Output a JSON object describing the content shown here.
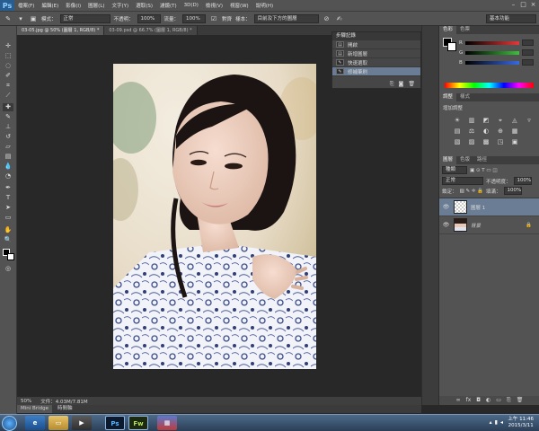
{
  "app": {
    "logo": "Ps"
  },
  "menubar": {
    "items": [
      "檔案(F)",
      "編輯(E)",
      "影像(I)",
      "圖層(L)",
      "文字(Y)",
      "選取(S)",
      "濾鏡(T)",
      "3D(D)",
      "檢視(V)",
      "視窗(W)",
      "說明(H)"
    ]
  },
  "options": {
    "mode_label": "模式：",
    "mode_value": "正常",
    "opacity_label": "不透明：",
    "opacity_value": "100%",
    "flow_label": "流量：",
    "flow_value": "100%",
    "align_label": "對齊",
    "sample_label": "樣本：",
    "sample_value": "目前及下方的圖層",
    "workspace": "基本功能"
  },
  "tabs": [
    {
      "label": "03-05.jpg @ 50% (圖層 1, RGB/8) *",
      "active": true
    },
    {
      "label": "03-09.psd @ 66.7% (圖層 1, RGB/8) *",
      "active": false
    }
  ],
  "history": {
    "title": "步驟記錄",
    "rows": [
      {
        "label": "開啟",
        "icon": "document-icon",
        "selected": false
      },
      {
        "label": "新增圖層",
        "icon": "layer-icon",
        "selected": false
      },
      {
        "label": "快速選取",
        "icon": "brush-icon",
        "selected": false
      },
      {
        "label": "修補筆刷",
        "icon": "brush-icon",
        "selected": true
      }
    ]
  },
  "status": {
    "zoom": "50%",
    "doc": "文件：4.03M/7.81M"
  },
  "bottom_tabs": [
    "Mini Bridge",
    "時間軸"
  ],
  "color_panel": {
    "tabs": [
      "色彩",
      "色票"
    ],
    "labels": [
      "R",
      "G",
      "B"
    ],
    "colors": {
      "r": "#e23a3a",
      "g": "#3ac23a",
      "b": "#3a6ae2"
    }
  },
  "adjust_panel": {
    "tabs": [
      "調整",
      "樣式"
    ],
    "title": "增加調整",
    "icons": [
      "☀",
      "▥",
      "◩",
      "⌖",
      "◬",
      "▿",
      "▤",
      "⚖",
      "◐",
      "⊕",
      "▦",
      "",
      "▧",
      "▨",
      "▩",
      "◳",
      "▣",
      ""
    ]
  },
  "layers_panel": {
    "tabs": [
      "圖層",
      "色版",
      "路徑"
    ],
    "kind": "種類",
    "blend": "正常",
    "opacity_label": "不透明度：",
    "opacity": "100%",
    "lock_label": "鎖定：",
    "fill_label": "填滿：",
    "fill": "100%",
    "layers": [
      {
        "name": "圖層 1",
        "selected": true,
        "lock": ""
      },
      {
        "name": "背景",
        "selected": false,
        "lock": "🔒"
      }
    ]
  },
  "taskbar": {
    "apps": [
      "Ps",
      "Fw"
    ],
    "time": "上午 11:46",
    "date": "2015/3/11"
  }
}
